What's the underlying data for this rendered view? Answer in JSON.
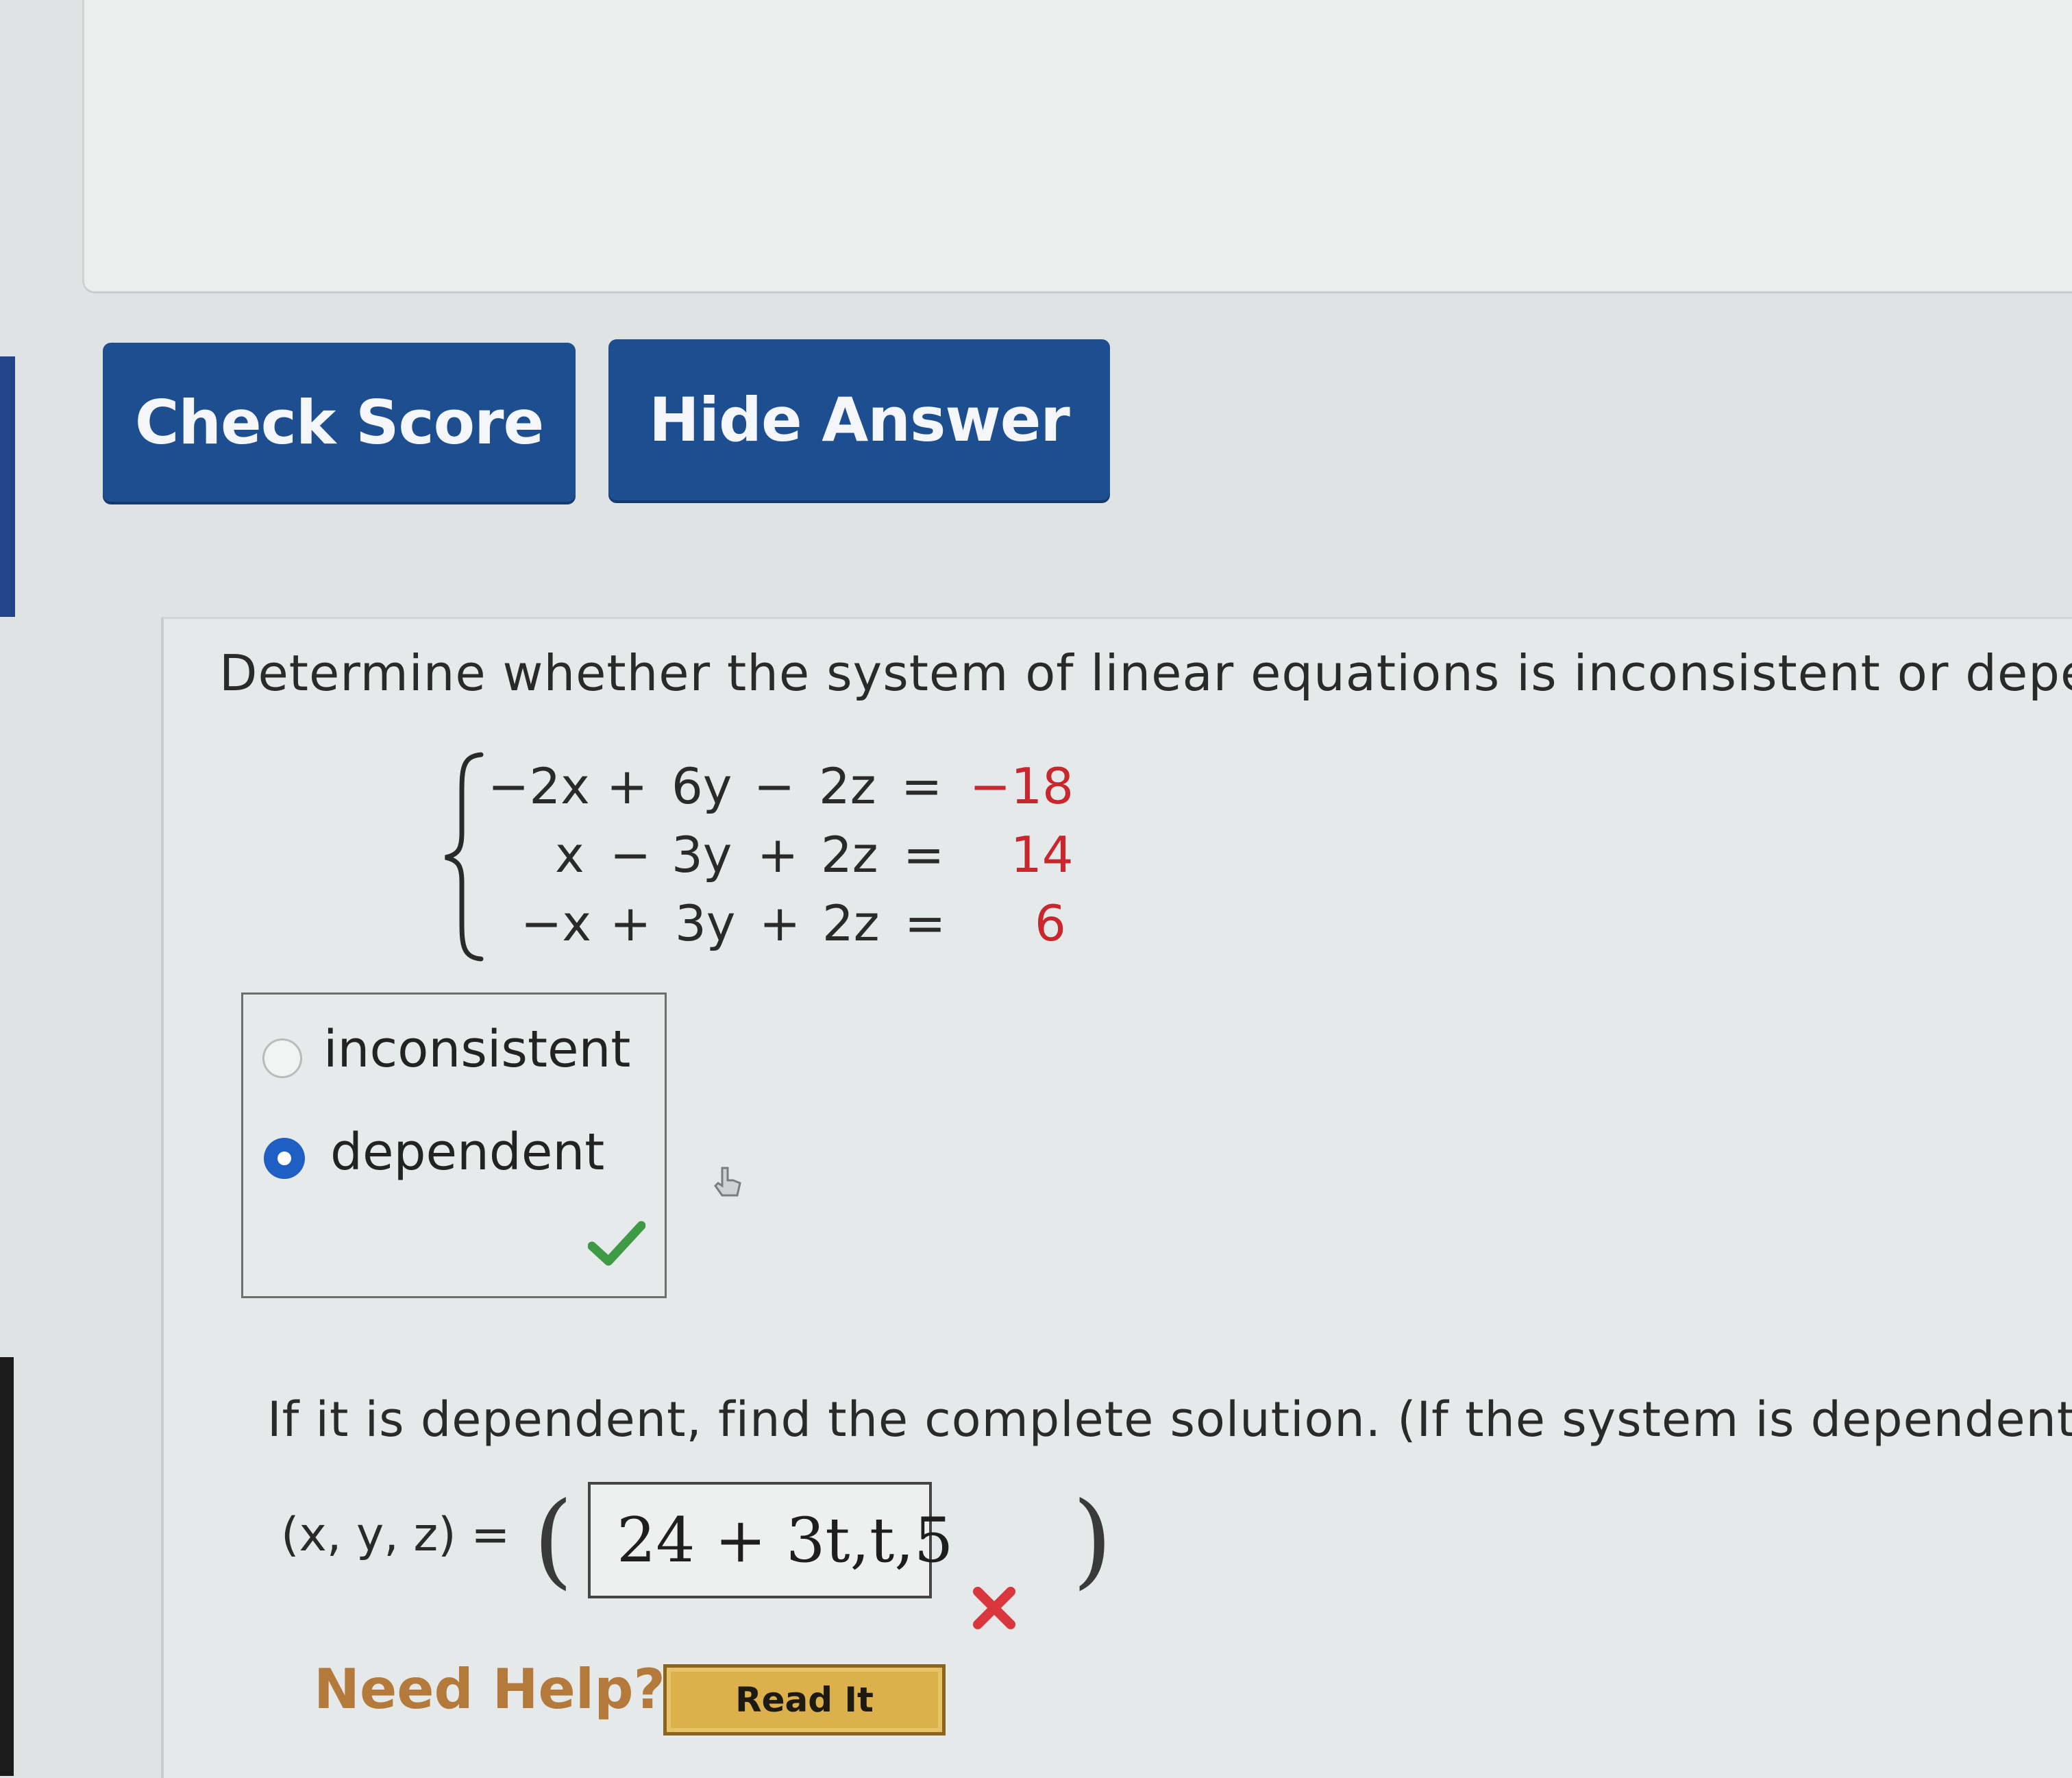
{
  "toolbar": {
    "check_score_label": "Check Score",
    "hide_answer_label": "Hide Answer"
  },
  "question": {
    "prompt": "Determine whether the system of linear equations is inconsistent or depe",
    "system": [
      {
        "lhs_1": "−2x",
        "op_1": "+",
        "term_2": "6y",
        "op_2": "−",
        "term_3": "2z",
        "eq": "=",
        "rhs": "−18"
      },
      {
        "lhs_1": "x",
        "op_1": "−",
        "term_2": "3y",
        "op_2": "+",
        "term_3": "2z",
        "eq": "=",
        "rhs": "14"
      },
      {
        "lhs_1": "−x",
        "op_1": "+",
        "term_2": "3y",
        "op_2": "+",
        "term_3": "2z",
        "eq": "=",
        "rhs": "6"
      }
    ],
    "options": [
      {
        "label": "inconsistent",
        "selected": false
      },
      {
        "label": "dependent",
        "selected": true
      }
    ],
    "status_icon": "check-icon",
    "status_color": "#3e9a44"
  },
  "part2": {
    "prompt": "If it is dependent, find the complete solution. (If the system is dependent, e",
    "solution_label": "(x, y, z) =",
    "open_paren": "(",
    "close_paren": ")",
    "answer_value": "24 + 3t,t,5",
    "status_icon": "x-icon",
    "status_color": "#d9363e"
  },
  "help": {
    "label": "Need Help?",
    "read_it_label": "Read It"
  }
}
